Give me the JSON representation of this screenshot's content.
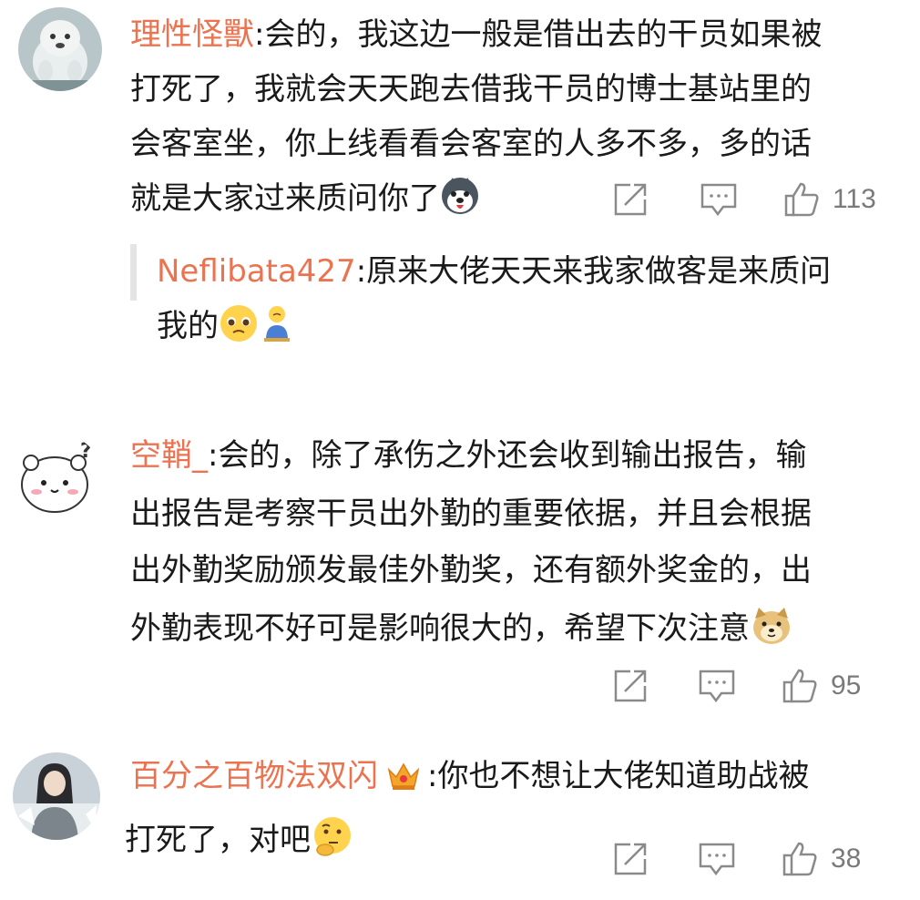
{
  "comments": [
    {
      "user": "理性怪獸",
      "lines": [
        "会的，我这边一般是借出去的干员如果被",
        "打死了，我就会天天跑去借我干员的博士基站里的",
        "会客室坐，你上线看看会客室的人多不多，多的话",
        "就是大家过来质问你了"
      ],
      "likes": "113",
      "emoji": "husky-dog-emoji",
      "reply": {
        "user": "Neflibata427",
        "lines": [
          "原来大佬天天来我家做客是来质问",
          "我的"
        ],
        "emojis": [
          "pleading-face-emoji",
          "sad-person-emoji"
        ]
      }
    },
    {
      "user": "空鞘_",
      "lines": [
        "会的，除了承伤之外还会收到输出报告，输",
        "出报告是考察干员出外勤的重要依据，并且会根据",
        "出外勤奖励颁发最佳外勤奖，还有额外奖金的，出",
        "外勤表现不好可是影响很大的，希望下次注意"
      ],
      "likes": "95",
      "emoji": "doge-emoji"
    },
    {
      "user": "百分之百物法双闪",
      "lines": [
        "你也不想让大佬知道助战被",
        "打死了，对吧"
      ],
      "likes": "38",
      "emoji": "thinking-face-emoji",
      "badge": "crown-badge"
    }
  ],
  "colon": ":",
  "colors": {
    "username": "#eb7350",
    "text": "#1a1a1a",
    "meta": "#7a7a7a",
    "icon": "#8a8a8a"
  }
}
